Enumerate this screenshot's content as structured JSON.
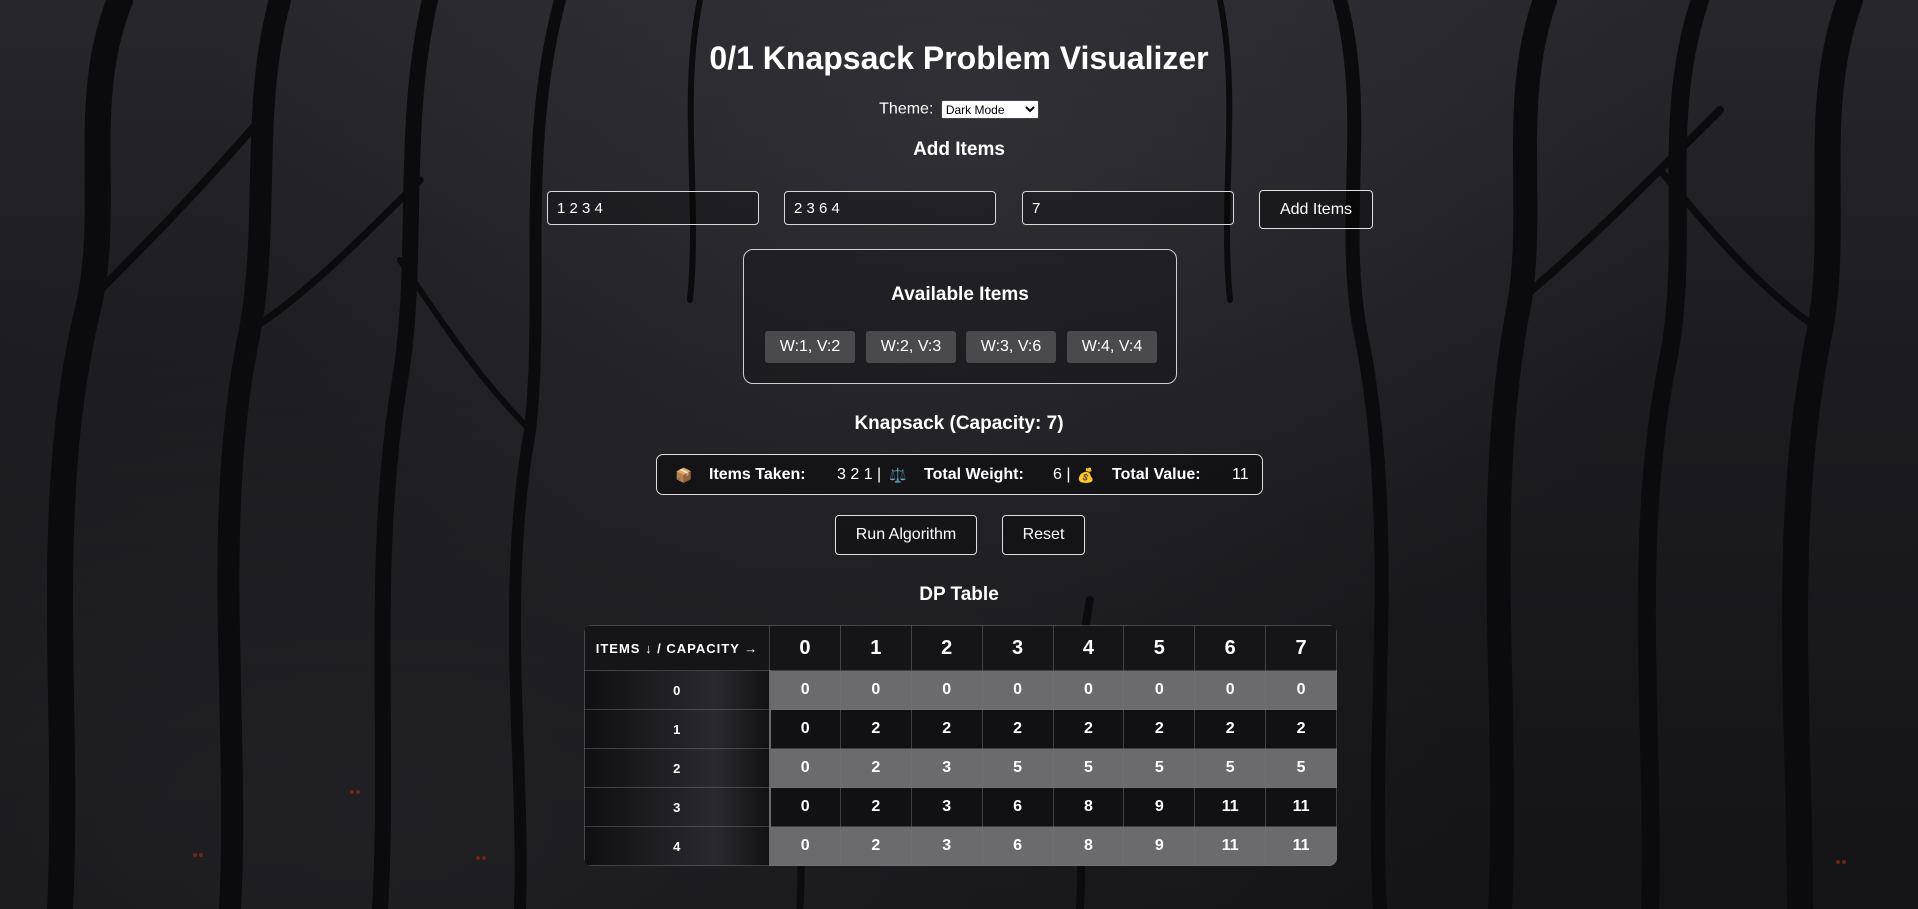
{
  "app": {
    "title": "0/1 Knapsack Problem Visualizer"
  },
  "theme": {
    "label": "Theme:",
    "selected": "Dark Mode"
  },
  "add_items": {
    "heading": "Add Items",
    "weights_value": "1 2 3 4",
    "values_value": "2 3 6 4",
    "capacity_value": "7",
    "button_label": "Add Items"
  },
  "available": {
    "heading": "Available Items",
    "items": [
      "W:1, V:2",
      "W:2, V:3",
      "W:3, V:6",
      "W:4, V:4"
    ]
  },
  "knapsack": {
    "heading": "Knapsack (Capacity: 7)",
    "taken_icon": "📦",
    "taken_label": "Items Taken:",
    "taken_value": "3 2 1 |",
    "weight_icon": "⚖️",
    "weight_label": "Total Weight:",
    "weight_value": "6 |",
    "value_icon": "💰",
    "value_label": "Total Value:",
    "value_value": "11"
  },
  "controls": {
    "run_label": "Run Algorithm",
    "reset_label": "Reset"
  },
  "dp_table": {
    "heading": "DP Table",
    "corner_label": "ITEMS ↓ / CAPACITY →",
    "capacities": [
      "0",
      "1",
      "2",
      "3",
      "4",
      "5",
      "6",
      "7"
    ],
    "rows": [
      {
        "item": "0",
        "cells": [
          "0",
          "0",
          "0",
          "0",
          "0",
          "0",
          "0",
          "0"
        ]
      },
      {
        "item": "1",
        "cells": [
          "0",
          "2",
          "2",
          "2",
          "2",
          "2",
          "2",
          "2"
        ]
      },
      {
        "item": "2",
        "cells": [
          "0",
          "2",
          "3",
          "5",
          "5",
          "5",
          "5",
          "5"
        ]
      },
      {
        "item": "3",
        "cells": [
          "0",
          "2",
          "3",
          "6",
          "8",
          "9",
          "11",
          "11"
        ]
      },
      {
        "item": "4",
        "cells": [
          "0",
          "2",
          "3",
          "6",
          "8",
          "9",
          "11",
          "11"
        ]
      }
    ]
  },
  "colors": {
    "background": "#18181c",
    "chip": "#4a4a4d",
    "row_light": "#6b6b6e",
    "row_dark": "#111114"
  }
}
